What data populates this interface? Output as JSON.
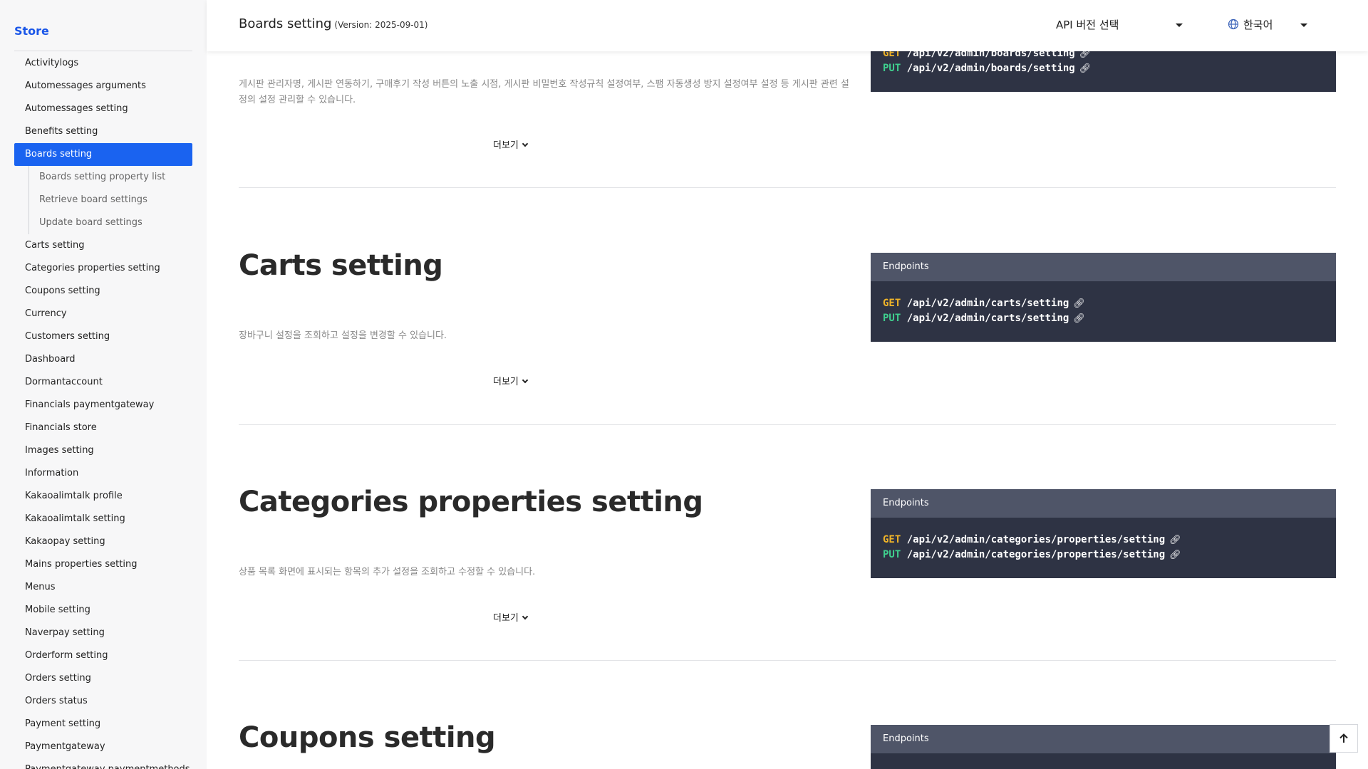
{
  "sidebar": {
    "title": "Store",
    "items_before": [
      "Activitylogs",
      "Automessages arguments",
      "Automessages setting",
      "Benefits setting"
    ],
    "active": "Boards setting",
    "subitems": [
      "Boards setting property list",
      "Retrieve board settings",
      "Update board settings"
    ],
    "items_after": [
      "Carts setting",
      "Categories properties setting",
      "Coupons setting",
      "Currency",
      "Customers setting",
      "Dashboard",
      "Dormantaccount",
      "Financials paymentgateway",
      "Financials store",
      "Images setting",
      "Information",
      "Kakaoalimtalk profile",
      "Kakaoalimtalk setting",
      "Kakaopay setting",
      "Mains properties setting",
      "Menus",
      "Mobile setting",
      "Naverpay setting",
      "Orderform setting",
      "Orders setting",
      "Orders status",
      "Payment setting",
      "Paymentgateway",
      "Paymentgateway paymentmethods"
    ]
  },
  "header": {
    "title": "Boards setting",
    "version": "(Version: 2025-09-01)",
    "api_select": "API 버전 선택",
    "language": "한국어"
  },
  "boards": {
    "endpoints": [
      {
        "method": "GET",
        "path": "/api/v2/admin/boards/setting"
      },
      {
        "method": "PUT",
        "path": "/api/v2/admin/boards/setting"
      }
    ],
    "description": "게시판 관리자명, 게시판 연동하기, 구매후기 작성 버튼의 노출 시점, 게시판 비밀번호 작성규칙 설정여부, 스팸 자동생성 방지 설정여부 설정 등 게시판 관련 설정의 설정 관리할 수 있습니다.",
    "more": "더보기"
  },
  "carts": {
    "title": "Carts setting",
    "endpoints_label": "Endpoints",
    "endpoints": [
      {
        "method": "GET",
        "path": "/api/v2/admin/carts/setting"
      },
      {
        "method": "PUT",
        "path": "/api/v2/admin/carts/setting"
      }
    ],
    "description": "장바구니 설정을 조회하고 설정을 변경할 수 있습니다.",
    "more": "더보기"
  },
  "categories": {
    "title": "Categories properties setting",
    "endpoints_label": "Endpoints",
    "endpoints": [
      {
        "method": "GET",
        "path": "/api/v2/admin/categories/properties/setting"
      },
      {
        "method": "PUT",
        "path": "/api/v2/admin/categories/properties/setting"
      }
    ],
    "description": "상품 목록 화면에 표시되는 항목의 추가 설정을 조회하고 수정할 수 있습니다.",
    "more": "더보기"
  },
  "coupons": {
    "title": "Coupons setting",
    "endpoints_label": "Endpoints"
  },
  "icons": {
    "link": "link-icon",
    "globe": "globe-icon",
    "caret": "caret-down-icon",
    "chevron": "chevron-down-icon",
    "to_top": "arrow-up-icon"
  },
  "colors": {
    "accent": "#1a63f0",
    "get": "#f0b429",
    "put": "#3fcf8e",
    "code_bg": "#2e3344",
    "code_head": "#4f5568"
  }
}
